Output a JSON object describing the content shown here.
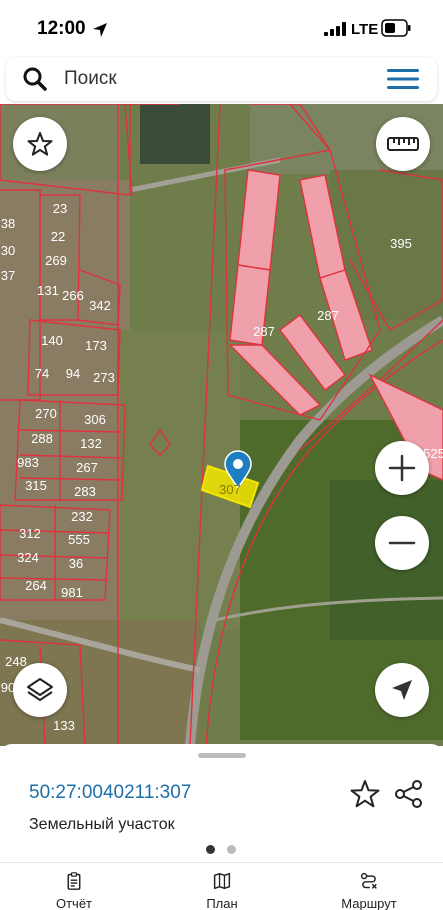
{
  "status": {
    "time": "12:00",
    "network": "LTE"
  },
  "search": {
    "placeholder": "Поиск"
  },
  "map": {
    "parcel_labels": [
      "23",
      "22",
      "269",
      "131",
      "266",
      "342",
      "140",
      "173",
      "74",
      "94",
      "273",
      "270",
      "306",
      "288",
      "132",
      "983",
      "267",
      "315",
      "283",
      "232",
      "312",
      "555",
      "324",
      "36",
      "264",
      "981",
      "248",
      "133",
      "287",
      "287",
      "395",
      "307",
      "525",
      "38",
      "30",
      "37",
      "90"
    ],
    "selected_parcel_label": "307"
  },
  "sheet": {
    "cadastral_number": "50:27:0040211:307",
    "object_type": "Земельный участок",
    "page_index": 0,
    "page_count": 2
  },
  "tabs": [
    {
      "label": "Отчёт",
      "icon": "report-icon"
    },
    {
      "label": "План",
      "icon": "map-icon"
    },
    {
      "label": "Маршрут",
      "icon": "route-icon"
    }
  ],
  "colors": {
    "accent": "#1e6fa8",
    "parcel_outline": "#e0313f",
    "selected_parcel": "#f2e600"
  }
}
